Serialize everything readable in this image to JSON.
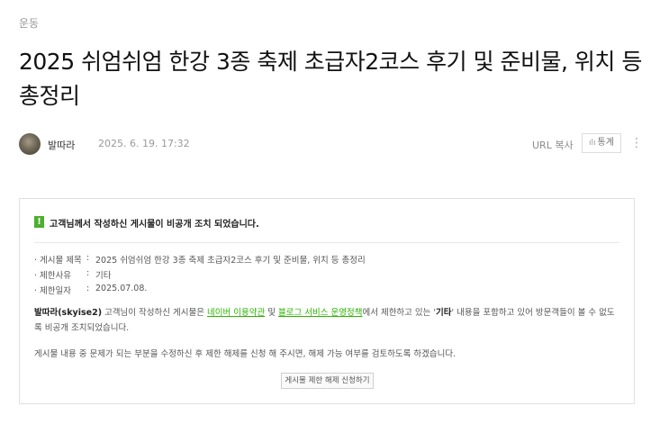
{
  "post": {
    "category": "운동",
    "title": "2025 쉬엄쉬엄 한강 3종 축제 초급자2코스 후기 및 준비물, 위치 등 총정리",
    "author": "발따라",
    "date": "2025. 6. 19. 17:32",
    "url_copy_label": "URL 복사",
    "stats_label": "통계",
    "more_label": "⋮"
  },
  "notice": {
    "heading": "고객님께서 작성하신 게시물이 비공개 조치 되었습니다.",
    "icon_glyph": "!",
    "accent_color": "#4caf2e",
    "rows": [
      {
        "label": "게시물 제목",
        "colon": ":",
        "value": "2025 쉬엄쉬엄 한강 3종 축제 초급자2코스 후기 및 준비물, 위치 등 총정리"
      },
      {
        "label": "제한사유",
        "colon": ":",
        "value": "기타"
      },
      {
        "label": "제한일자",
        "colon": ":",
        "value": "2025.07.08."
      }
    ],
    "body": {
      "user": "발따라(skyise2)",
      "part1": " 고객님이 작성하신 게시물은 ",
      "link1": "네이버 이용약관",
      "part2": " 및 ",
      "link2": "블로그 서비스 운영정책",
      "part3": "에서 제한하고 있는 '",
      "reason": "기타",
      "part4": "' 내용을 포함하고 있어 방문객들이 볼 수 없도록 비공개 조치되었습니다."
    },
    "body2": "게시물 내용 중 문제가 되는 부분을 수정하신 후 제한 해제를 신청 해 주시면, 해제 가능 여부를 검토하도록 하겠습니다.",
    "release_button": "게시물 제한 해제 신청하기",
    "link_color": "#2db400"
  }
}
